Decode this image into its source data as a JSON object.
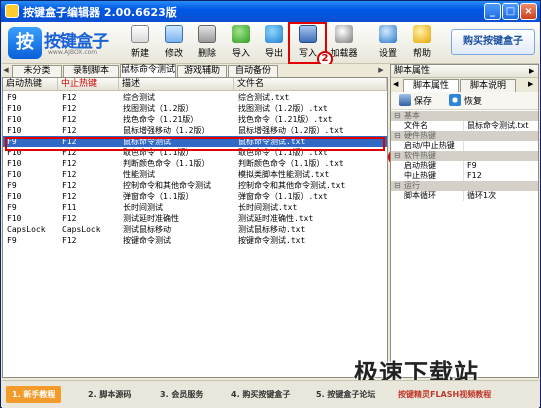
{
  "window": {
    "title": "按键盒子编辑器  2.00.6623版",
    "controls": [
      "_",
      "□",
      "×"
    ]
  },
  "logo": {
    "text": "按键盒子",
    "sub": "www.AJBOX.com",
    "mark": "按"
  },
  "toolbar": {
    "new": "新建",
    "edit": "修改",
    "delete": "删除",
    "import": "导入",
    "export": "导出",
    "write": "写入",
    "load": "加载器",
    "settings": "设置",
    "help": "帮助",
    "buy": "购买按键盒子"
  },
  "callouts": {
    "first": "1",
    "second": "2"
  },
  "tabs": [
    "未分类",
    "录制脚本",
    "鼠标命令测试",
    "游戏辅助",
    "自动备份"
  ],
  "list": {
    "headers": [
      "启动热键",
      "中止热键",
      "描述",
      "文件名"
    ],
    "rows": [
      [
        "F9",
        "F12",
        "综合测试",
        "综合测试.txt"
      ],
      [
        "F10",
        "F12",
        "找图测试（1.2版）",
        "找图测试（1.2版）.txt"
      ],
      [
        "F10",
        "F12",
        "找色命令（1.21版）",
        "找色命令（1.21版）.txt"
      ],
      [
        "F10",
        "F12",
        "鼠标增强移动（1.2版）",
        "鼠标增强移动（1.2版）.txt"
      ],
      [
        "F9",
        "F12",
        "鼠标命令测试",
        "鼠标命令测试.txt"
      ],
      [
        "F10",
        "F12",
        "取色命令（1.1版）",
        "取色命令（1.1版）.txt"
      ],
      [
        "F10",
        "F12",
        "判断颜色命令（1.1版）",
        "判断颜色命令（1.1版）.txt"
      ],
      [
        "F10",
        "F12",
        "性能测试",
        "模拟类脚本性能测试.txt"
      ],
      [
        "F9",
        "F12",
        "控制命令和其他命令测试",
        "控制命令和其他命令测试.txt"
      ],
      [
        "F10",
        "F12",
        "弹窗命令（1.1版）",
        "弹窗命令（1.1版）.txt"
      ],
      [
        "F9",
        "F11",
        "长时间测试",
        "长时间测试.txt"
      ],
      [
        "F10",
        "F12",
        "测试延时准确性",
        "测试延时准确性.txt"
      ],
      [
        "CapsLock",
        "CapsLock",
        "测试鼠标移动",
        "测试鼠标移动.txt"
      ],
      [
        "F9",
        "F12",
        "按键命令测试",
        "按键命令测试.txt"
      ]
    ],
    "selected_index": 4
  },
  "props": {
    "title": "脚本属性",
    "tabs": [
      "脚本属性",
      "脚本说明"
    ],
    "save": "保存",
    "restore": "恢复",
    "rows": [
      {
        "type": "cat",
        "key": "基本"
      },
      {
        "type": "line",
        "key": "文件名",
        "value": "鼠标命令测试.txt"
      },
      {
        "type": "cat",
        "key": "硬件热键"
      },
      {
        "type": "line",
        "key": "启动/中止热键",
        "value": ""
      },
      {
        "type": "cat",
        "key": "软件热键"
      },
      {
        "type": "line",
        "key": "启动热键",
        "value": "F9"
      },
      {
        "type": "line",
        "key": "中止热键",
        "value": "F12"
      },
      {
        "type": "cat",
        "key": "运行"
      },
      {
        "type": "line",
        "key": "脚本循环",
        "value": "循环1次"
      }
    ]
  },
  "statusbar": [
    "1. 新手教程",
    "2. 脚本源码",
    "3. 会员服务",
    "4. 购买按键盒子",
    "5. 按键盒子论坛",
    "按键精灵FLASH视频教程"
  ],
  "watermark": "极速下载站"
}
